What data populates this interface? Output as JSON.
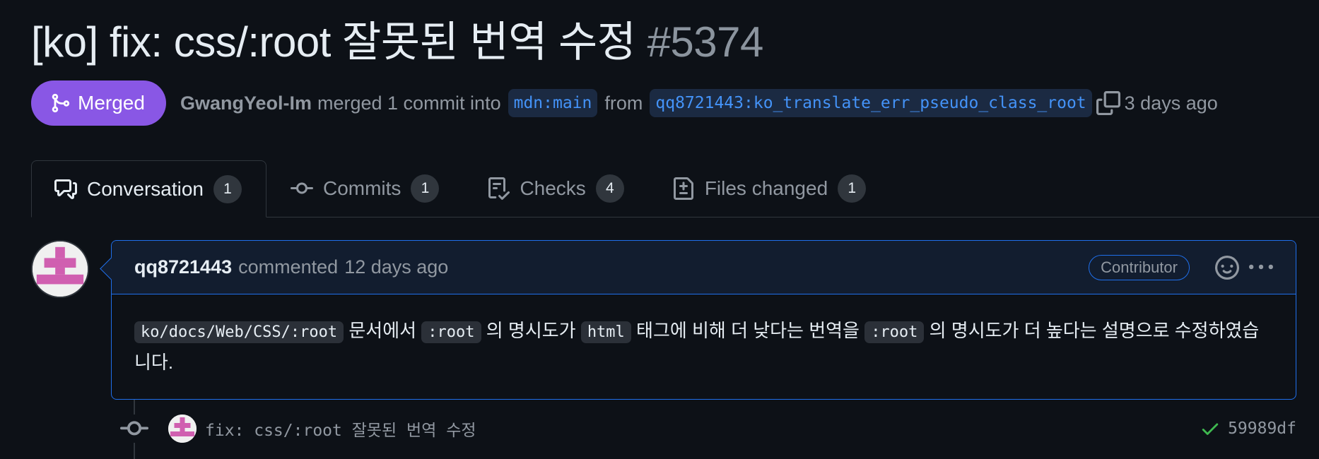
{
  "pr": {
    "title": "[ko] fix: css/:root 잘못된 번역 수정",
    "number": "#5374",
    "state": "Merged",
    "author": "GwangYeol-Im",
    "merged_text": "merged 1 commit into",
    "base_branch": "mdn:main",
    "from_text": "from",
    "head_branch": "qq8721443:ko_translate_err_pseudo_class_root",
    "time": "3 days ago"
  },
  "tabs": [
    {
      "label": "Conversation",
      "count": "1",
      "icon": "comment-discussion-icon"
    },
    {
      "label": "Commits",
      "count": "1",
      "icon": "git-commit-icon"
    },
    {
      "label": "Checks",
      "count": "4",
      "icon": "checklist-icon"
    },
    {
      "label": "Files changed",
      "count": "1",
      "icon": "file-diff-icon"
    }
  ],
  "comment": {
    "author": "qq8721443",
    "action": "commented",
    "time": "12 days ago",
    "role": "Contributor",
    "body": {
      "code1": "ko/docs/Web/CSS/:root",
      "t1": " 문서에서 ",
      "code2": ":root",
      "t2": " 의 명시도가 ",
      "code3": "html",
      "t3": " 태그에 비해 더 낮다는 번역을 ",
      "code4": ":root",
      "t4": " 의 명시도가 더 높다는 설명으로 수정하였습니다."
    }
  },
  "commit": {
    "message": "fix: css/:root 잘못된 번역 수정",
    "sha": "59989df"
  },
  "colors": {
    "merged": "#8957e5",
    "accent": "#4493f8",
    "success": "#3fb950",
    "avatar_pink": "#d05fb0"
  }
}
